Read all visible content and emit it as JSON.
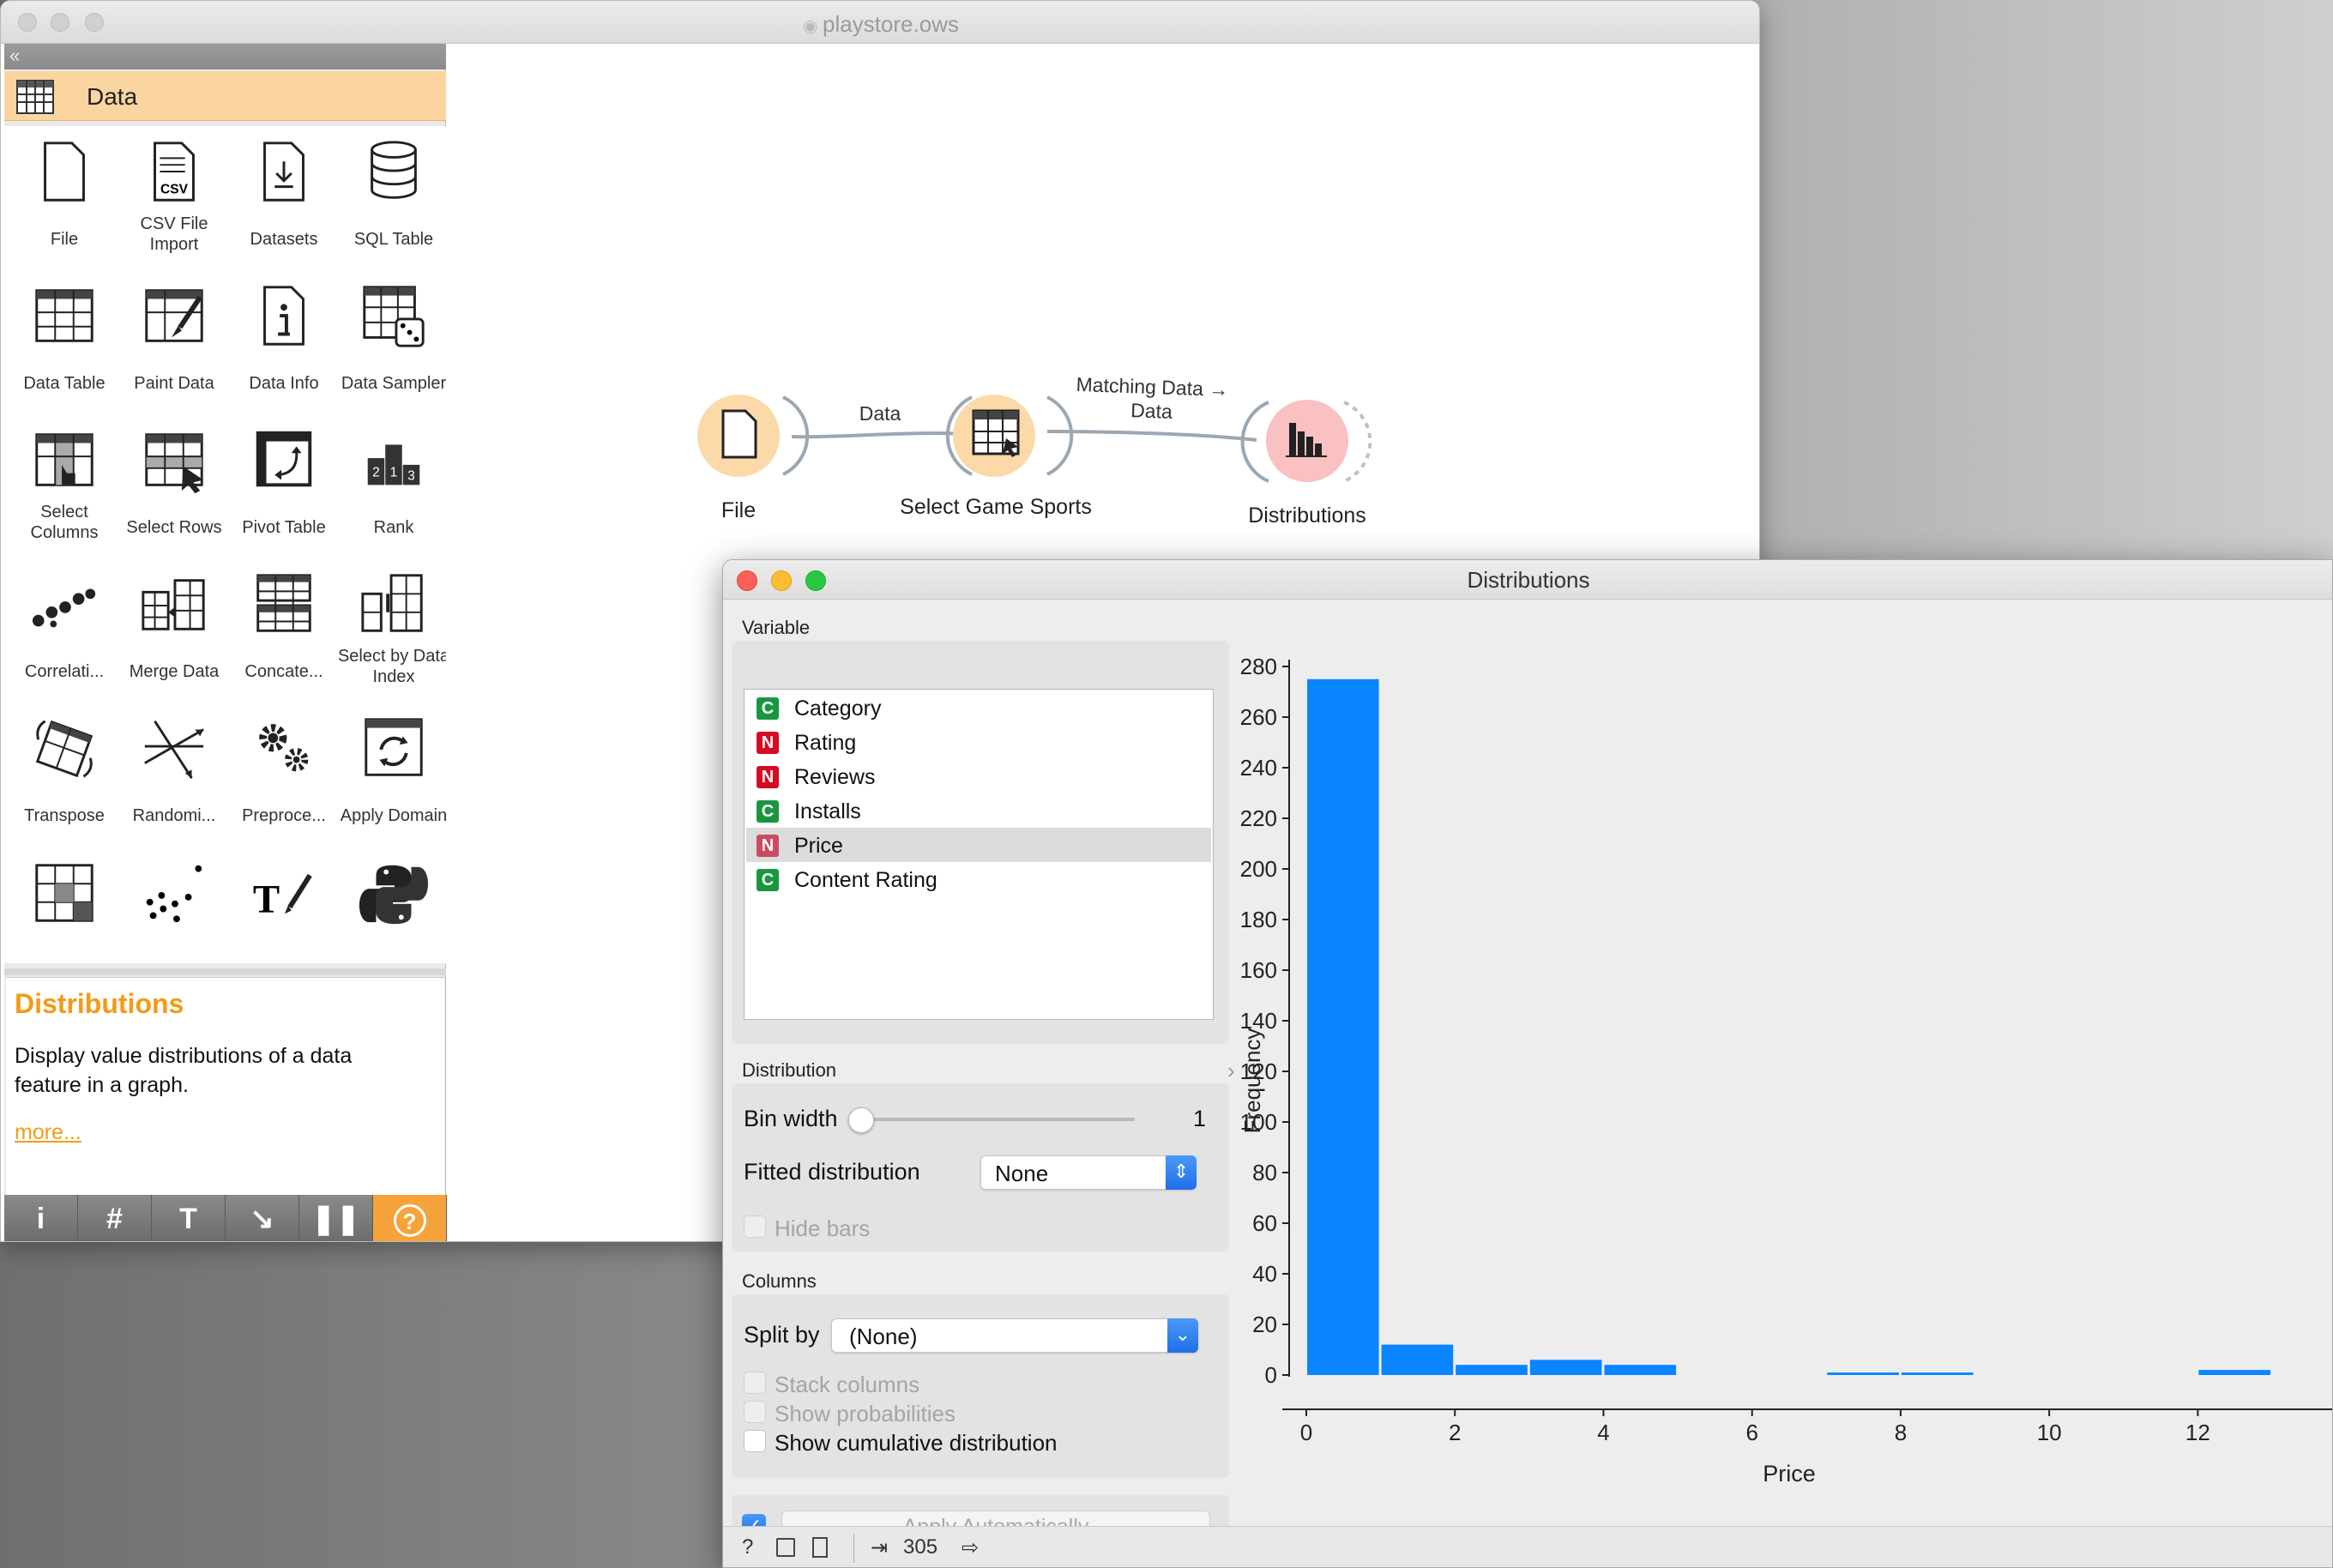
{
  "main_window": {
    "title": "playstore.ows"
  },
  "toolbox": {
    "collapse_glyph": "«",
    "category": "Data",
    "widgets": [
      {
        "label": "File",
        "icon": "file-icon"
      },
      {
        "label": "CSV File Import",
        "icon": "csv-file-icon"
      },
      {
        "label": "Datasets",
        "icon": "datasets-icon"
      },
      {
        "label": "SQL Table",
        "icon": "database-icon"
      },
      {
        "label": "Data Table",
        "icon": "table-icon"
      },
      {
        "label": "Paint Data",
        "icon": "paint-brush-icon"
      },
      {
        "label": "Data Info",
        "icon": "info-document-icon"
      },
      {
        "label": "Data Sampler",
        "icon": "dice-table-icon"
      },
      {
        "label": "Select Columns",
        "icon": "select-columns-icon"
      },
      {
        "label": "Select Rows",
        "icon": "select-rows-icon"
      },
      {
        "label": "Pivot Table",
        "icon": "pivot-icon"
      },
      {
        "label": "Rank",
        "icon": "rank-podium-icon"
      },
      {
        "label": "Correlati...",
        "icon": "correlation-dots-icon"
      },
      {
        "label": "Merge Data",
        "icon": "merge-icon"
      },
      {
        "label": "Concate...",
        "icon": "concatenate-icon"
      },
      {
        "label": "Select by Data Index",
        "icon": "select-by-index-icon"
      },
      {
        "label": "Transpose",
        "icon": "transpose-icon"
      },
      {
        "label": "Randomi...",
        "icon": "randomize-icon"
      },
      {
        "label": "Preproce...",
        "icon": "gears-icon"
      },
      {
        "label": "Apply Domain",
        "icon": "apply-domain-icon"
      },
      {
        "label": "",
        "icon": "grid-icon"
      },
      {
        "label": "",
        "icon": "scatter-dots-icon"
      },
      {
        "label": "",
        "icon": "text-edit-icon"
      },
      {
        "label": "",
        "icon": "python-icon"
      }
    ],
    "help": {
      "title": "Distributions",
      "description": "Display value distributions of a data feature in a graph.",
      "more": "more..."
    },
    "toolbar": [
      {
        "glyph": "i",
        "icon": "info-icon"
      },
      {
        "glyph": "#",
        "icon": "grid-hash-icon"
      },
      {
        "glyph": "T",
        "icon": "text-annotation-icon"
      },
      {
        "glyph": "↘",
        "icon": "arrow-annotation-icon"
      },
      {
        "glyph": "❚❚",
        "icon": "pause-icon"
      },
      {
        "glyph": "?",
        "icon": "help-icon"
      }
    ]
  },
  "workflow": {
    "nodes": [
      {
        "label": "File",
        "color": "#fcd9a9"
      },
      {
        "label": "Select Game Sports",
        "color": "#fcd9a9"
      },
      {
        "label": "Distributions",
        "color": "#f9c1c1"
      }
    ],
    "links": [
      {
        "label": "Data"
      },
      {
        "label": "Matching Data → Data"
      }
    ]
  },
  "distributions": {
    "title": "Distributions",
    "variable_label": "Variable",
    "variables": [
      {
        "type": "C",
        "name": "Category",
        "color": "#1a9641"
      },
      {
        "type": "N",
        "name": "Rating",
        "color": "#d40b23"
      },
      {
        "type": "N",
        "name": "Reviews",
        "color": "#d40b23"
      },
      {
        "type": "C",
        "name": "Installs",
        "color": "#1a9641"
      },
      {
        "type": "N",
        "name": "Price",
        "color": "#d40b23"
      },
      {
        "type": "C",
        "name": "Content Rating",
        "color": "#1a9641"
      }
    ],
    "selected_variable": "Price",
    "distribution_label": "Distribution",
    "bin_width_label": "Bin width",
    "bin_width_value": "1",
    "fitted_label": "Fitted distribution",
    "fitted_value": "None",
    "hide_bars": "Hide bars",
    "columns_label": "Columns",
    "split_by_label": "Split by",
    "split_by_value": "(None)",
    "stack_columns": "Stack columns",
    "show_probabilities": "Show probabilities",
    "show_cumulative": "Show cumulative distribution",
    "apply_auto": "Apply Automatically",
    "apply_checked": true,
    "status_count": "305"
  },
  "chart_data": {
    "type": "bar",
    "xlabel": "Price",
    "ylabel": "Frequency",
    "xlim": [
      0,
      13
    ],
    "ylim": [
      0,
      280
    ],
    "xticks": [
      0,
      2,
      4,
      6,
      8,
      10,
      12
    ],
    "yticks": [
      0,
      20,
      40,
      60,
      80,
      100,
      120,
      140,
      160,
      180,
      200,
      220,
      240,
      260,
      280
    ],
    "bins": [
      {
        "x0": 0,
        "x1": 1,
        "value": 275
      },
      {
        "x0": 1,
        "x1": 2,
        "value": 12
      },
      {
        "x0": 2,
        "x1": 3,
        "value": 4
      },
      {
        "x0": 3,
        "x1": 4,
        "value": 6
      },
      {
        "x0": 4,
        "x1": 5,
        "value": 4
      },
      {
        "x0": 5,
        "x1": 6,
        "value": 0
      },
      {
        "x0": 6,
        "x1": 7,
        "value": 0
      },
      {
        "x0": 7,
        "x1": 8,
        "value": 1
      },
      {
        "x0": 8,
        "x1": 9,
        "value": 1
      },
      {
        "x0": 9,
        "x1": 10,
        "value": 0
      },
      {
        "x0": 10,
        "x1": 11,
        "value": 0
      },
      {
        "x0": 11,
        "x1": 12,
        "value": 0
      },
      {
        "x0": 12,
        "x1": 13,
        "value": 2
      }
    ],
    "bar_color": "#0a84ff",
    "grid": false
  }
}
